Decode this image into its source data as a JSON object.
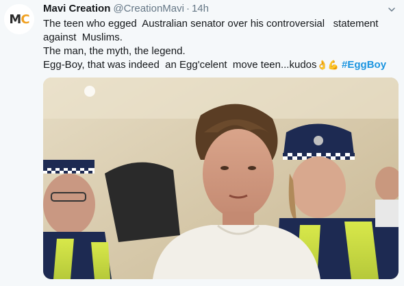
{
  "tweet": {
    "author": {
      "avatar_letters_1": "M",
      "avatar_letters_2": "C",
      "display_name": "Mavi Creation",
      "handle": "@CreationMavi",
      "separator": "·",
      "time": "14h"
    },
    "text_lines": [
      "The teen who egged  Australian senator over his controversial   statement",
      "against  Muslims.",
      "The man, the myth, the legend.",
      "Egg-Boy, that was indeed  an Egg'celent  move teen...kudos"
    ],
    "emoji": "👌💪",
    "hashtag": "#EggBoy",
    "menu_icon": "chevron-down-icon",
    "media": {
      "type": "photo",
      "icon": "photo"
    }
  },
  "colors": {
    "background": "#f5f8fa",
    "text": "#14171a",
    "secondary": "#657786",
    "link": "#1b95e0",
    "avatar_accent": "#f0a020"
  }
}
